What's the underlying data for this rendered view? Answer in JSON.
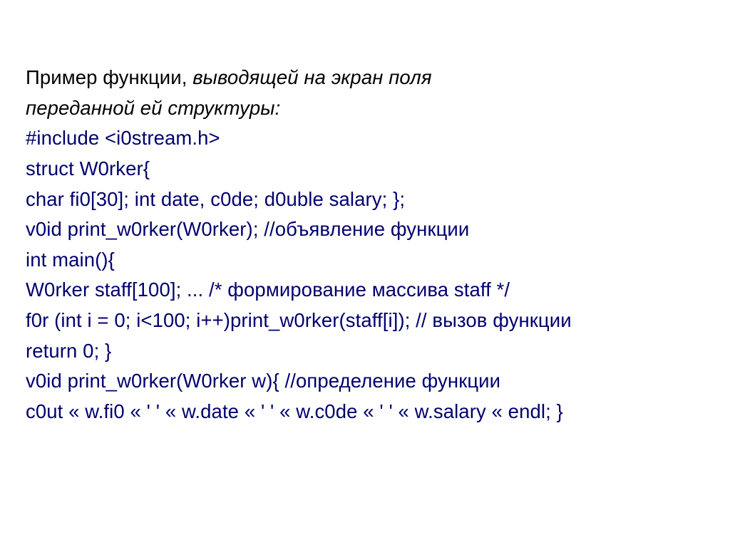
{
  "heading": {
    "line1_plain": "Пример функции, ",
    "line1_italic": "выводящей на экран поля",
    "line2_italic": "переданной ей структуры:"
  },
  "code": {
    "l1": "#include <i0stream.h>",
    "l2": "struct W0rker{",
    "l3": "char fi0[30]; int date, c0de; d0uble salary; };",
    "l4": "v0id print_w0rker(W0rker); //объявление функции",
    "l5": "int main(){",
    "l6": "W0rker staff[100]; ... /* формирование массива staff */",
    "l7": "f0r (int i = 0; i<100; i++)print_w0rker(staff[i]); // вызов функции",
    "l8": "return 0; }",
    "l9": "v0id print_w0rker(W0rker w){ //определение функции",
    "l10": "c0ut « w.fi0 « ' ' « w.date « ' ' « w.c0de « ' ' « w.salary « endl; }"
  }
}
